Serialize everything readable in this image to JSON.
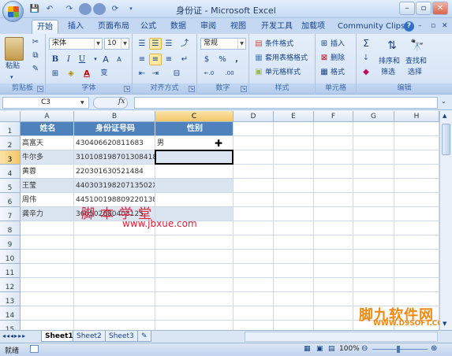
{
  "window": {
    "title": "身份证 - Microsoft Excel",
    "min": "–",
    "restore": "▫",
    "close": "✕"
  },
  "qat": [
    "💾",
    "↶",
    "↷",
    "⟳"
  ],
  "tabs": [
    {
      "label": "开始",
      "active": true
    },
    {
      "label": "插入"
    },
    {
      "label": "页面布局"
    },
    {
      "label": "公式"
    },
    {
      "label": "数据"
    },
    {
      "label": "审阅"
    },
    {
      "label": "视图"
    },
    {
      "label": "开发工具"
    },
    {
      "label": "加载项"
    },
    {
      "label": "Community Clips"
    }
  ],
  "ribbon": {
    "clipboard": {
      "label": "剪贴板",
      "paste": "粘贴"
    },
    "font": {
      "label": "字体",
      "name": "宋体",
      "size": "10",
      "bold": "B",
      "italic": "I",
      "underline": "U",
      "grow": "A",
      "shrink": "A",
      "color_a": "A",
      "wen": "变"
    },
    "align": {
      "label": "对齐方式"
    },
    "number": {
      "label": "数字",
      "format": "常规",
      "currency": "$",
      "percent": "%",
      "comma": ",",
      "inc": "←.0",
      "dec": ".00"
    },
    "styles": {
      "label": "样式",
      "cond": "条件格式",
      "table": "套用表格格式",
      "cell": "单元格样式"
    },
    "cells": {
      "label": "单元格",
      "insert": "插入",
      "delete": "删除",
      "format": "格式"
    },
    "editing": {
      "label": "编辑",
      "sigma": "Σ",
      "sort": "排序和",
      "sort2": "筛选",
      "find": "查找和",
      "find2": "选择"
    }
  },
  "formula": {
    "namebox": "C3",
    "fx": "fx",
    "content": ""
  },
  "columns": [
    "A",
    "B",
    "C",
    "D",
    "E",
    "F",
    "G",
    "H"
  ],
  "rows": [
    "1",
    "2",
    "3",
    "4",
    "5",
    "6",
    "7",
    "8",
    "9",
    "10",
    "11",
    "12",
    "13",
    "14",
    "15",
    "16",
    "17"
  ],
  "table": {
    "headers": [
      "姓名",
      "身份证号码",
      "性别"
    ],
    "rows": [
      {
        "name": "高富天",
        "id": "430406620811683",
        "sex": "男"
      },
      {
        "name": "牛尔多",
        "id": "310108198701308418",
        "sex": ""
      },
      {
        "name": "黄蓉",
        "id": "220301630521484",
        "sex": ""
      },
      {
        "name": "王莹",
        "id": "44030319820713502X",
        "sex": ""
      },
      {
        "name": "周伟",
        "id": "445100198809220138",
        "sex": ""
      },
      {
        "name": "龚辛力",
        "id": "360502680403125",
        "sex": ""
      }
    ]
  },
  "sheets": [
    {
      "label": "Sheet1",
      "active": true
    },
    {
      "label": "Sheet2"
    },
    {
      "label": "Sheet3"
    }
  ],
  "status": {
    "ready": "就绪",
    "zoom": "100%",
    "minus": "⊖",
    "plus": "⊕"
  },
  "watermarks": {
    "cn": "脚本学堂",
    "url": "www.jbxue.com",
    "brand": "脚九软件网",
    "brand_url": "WWW.D9SOFT.COM"
  }
}
